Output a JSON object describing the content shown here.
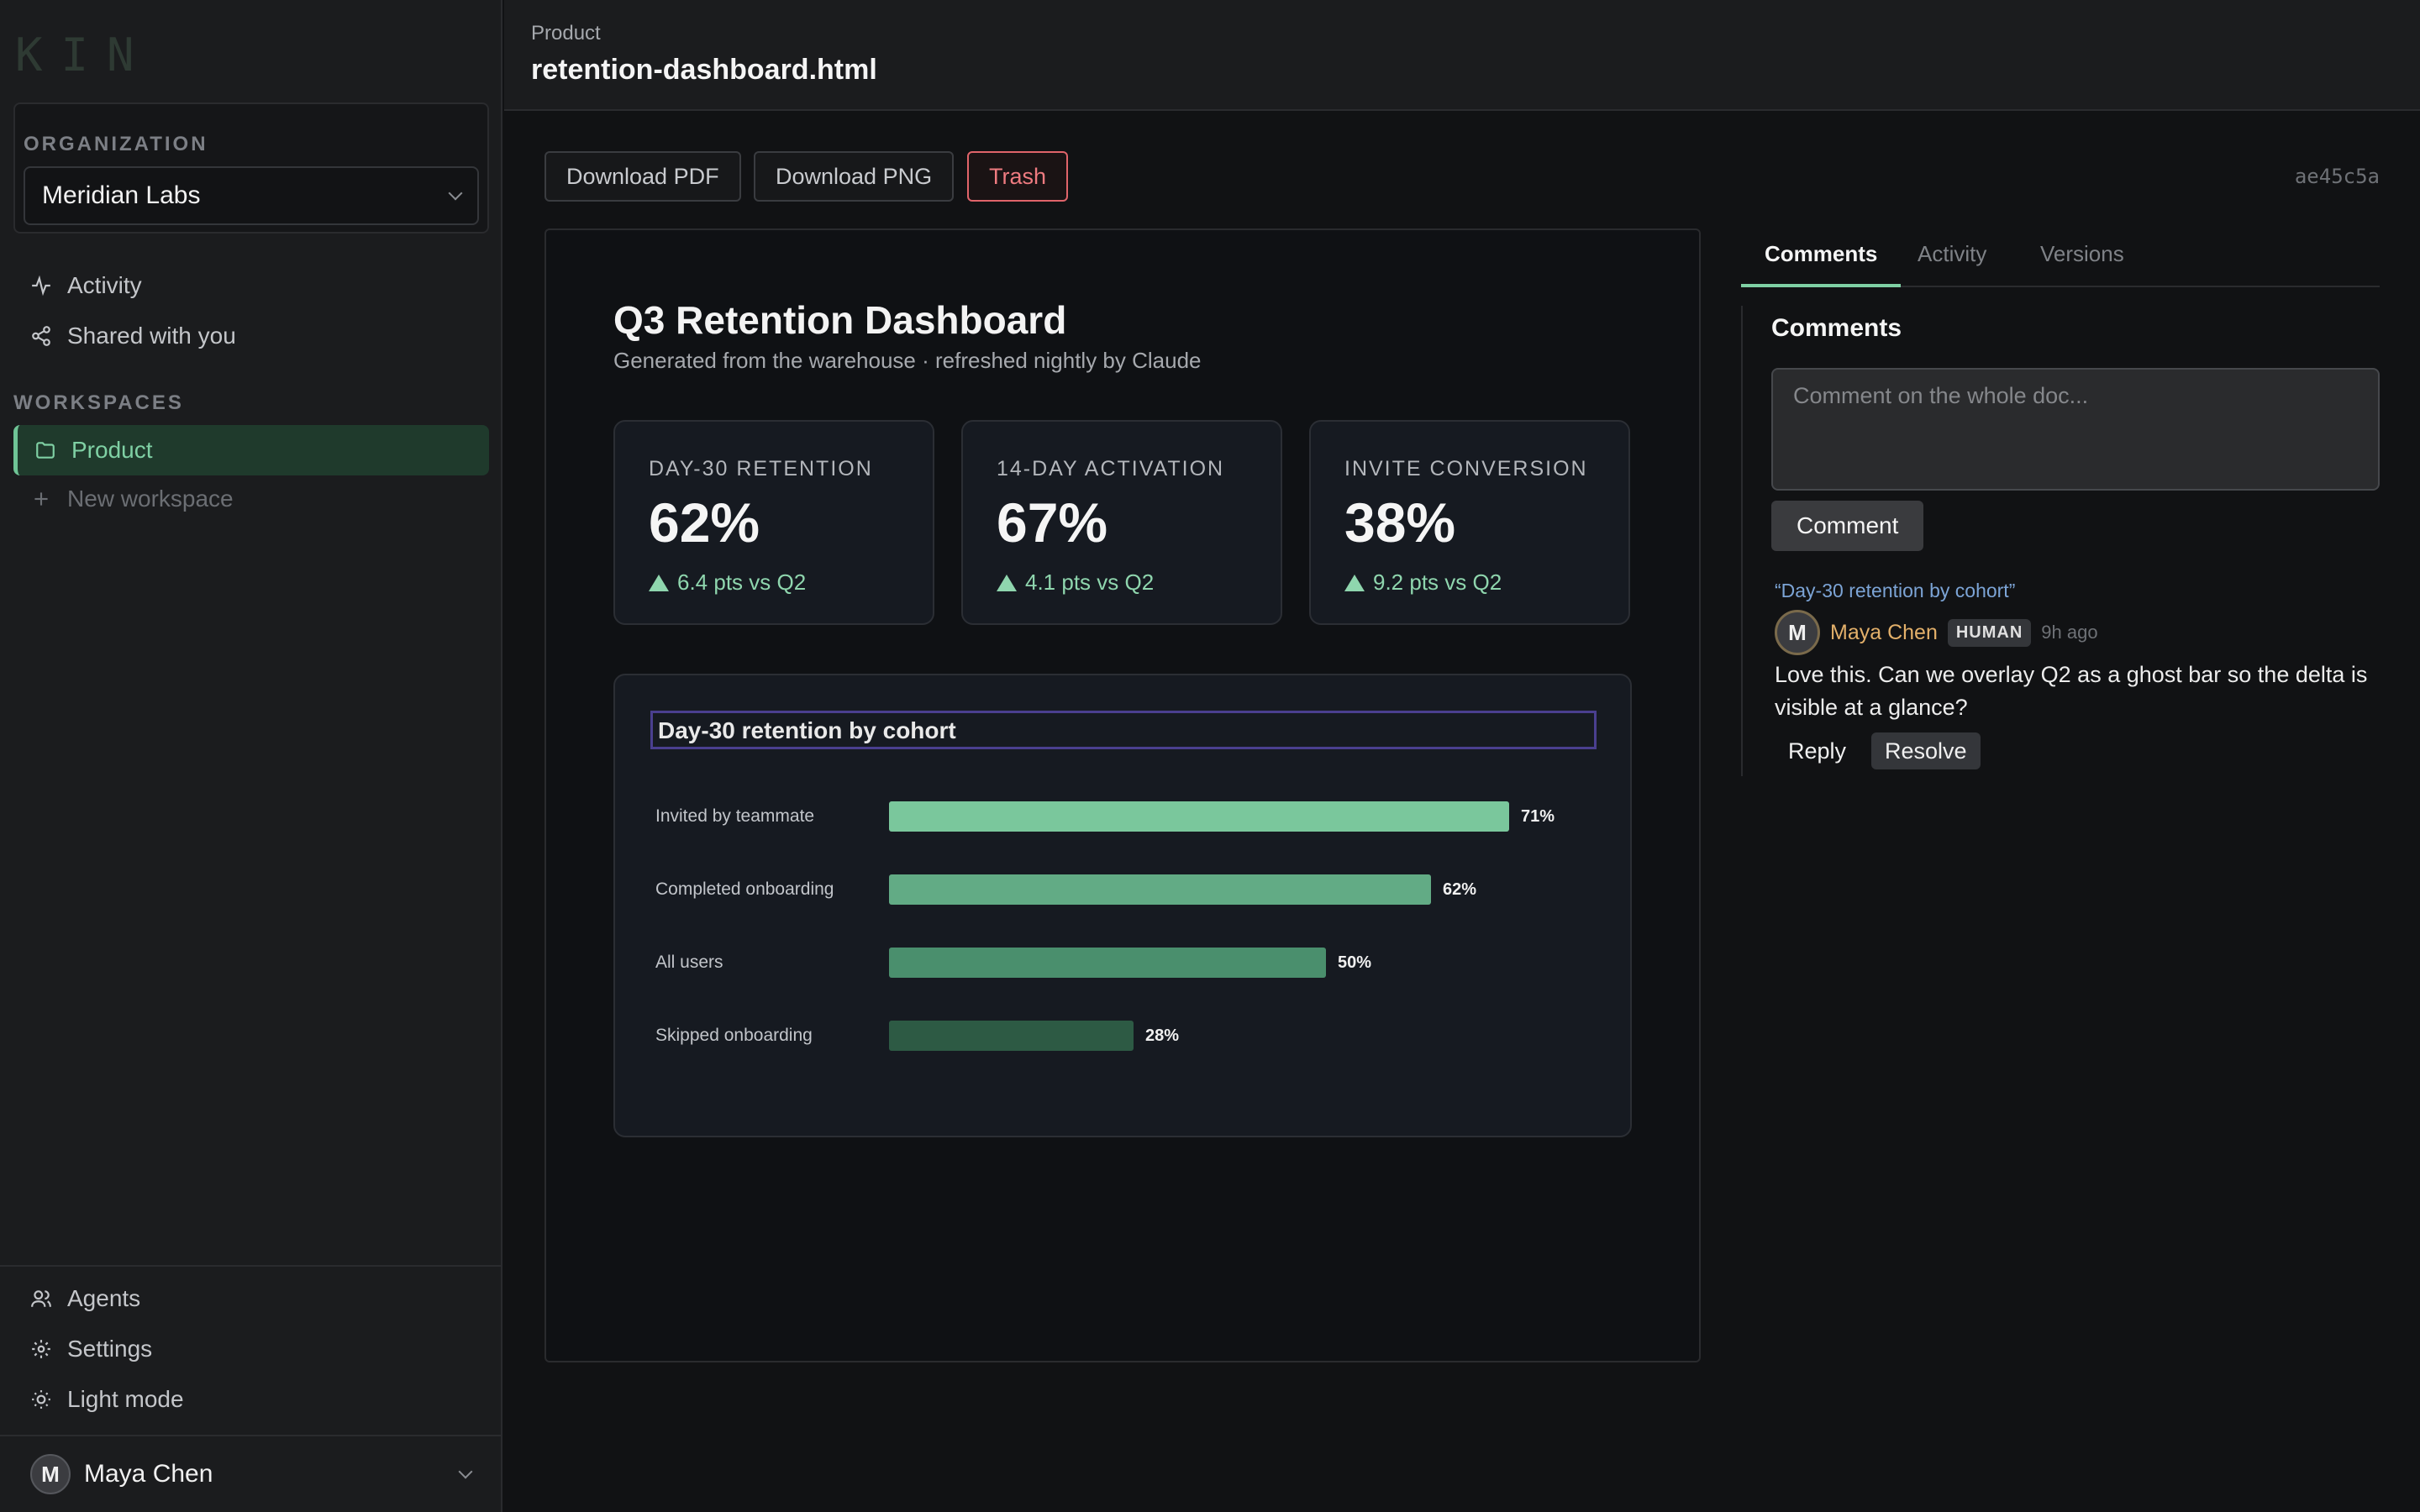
{
  "sidebar": {
    "logo": "KIN",
    "org_label": "ORGANIZATION",
    "org_value": "Meridian Labs",
    "nav": [
      {
        "label": "Activity",
        "icon": "activity-icon"
      },
      {
        "label": "Shared with you",
        "icon": "share-icon"
      }
    ],
    "workspaces_label": "WORKSPACES",
    "workspaces": [
      {
        "label": "Product",
        "icon": "folder-icon",
        "active": true
      }
    ],
    "new_workspace": "New workspace",
    "bottom": [
      {
        "label": "Agents",
        "icon": "users-icon"
      },
      {
        "label": "Settings",
        "icon": "gear-icon"
      },
      {
        "label": "Light mode",
        "icon": "sun-icon"
      }
    ],
    "user": {
      "initial": "M",
      "name": "Maya Chen"
    }
  },
  "header": {
    "breadcrumb": "Product",
    "filename": "retention-dashboard.html"
  },
  "toolbar": {
    "download_pdf": "Download PDF",
    "download_png": "Download PNG",
    "trash": "Trash",
    "hash": "ae45c5a"
  },
  "document": {
    "title": "Q3 Retention Dashboard",
    "subtitle": "Generated from the warehouse · refreshed nightly by Claude",
    "kpis": [
      {
        "label": "DAY-30 RETENTION",
        "value": "62%",
        "delta": "6.4 pts vs Q2"
      },
      {
        "label": "14-DAY ACTIVATION",
        "value": "67%",
        "delta": "4.1 pts vs Q2"
      },
      {
        "label": "INVITE CONVERSION",
        "value": "38%",
        "delta": "9.2 pts vs Q2"
      }
    ]
  },
  "chart_data": {
    "type": "bar",
    "title": "Day-30 retention by cohort",
    "categories": [
      "Invited by teammate",
      "Completed onboarding",
      "All users",
      "Skipped onboarding"
    ],
    "values": [
      71,
      62,
      50,
      28
    ],
    "value_labels": [
      "71%",
      "62%",
      "50%",
      "28%"
    ],
    "colors": [
      "#7ac79c",
      "#62ab85",
      "#4a8f6d",
      "#2d5a44"
    ],
    "xlim": [
      0,
      100
    ],
    "grid": false
  },
  "panel": {
    "tabs": [
      "Comments",
      "Activity",
      "Versions"
    ],
    "active_tab": "Comments",
    "heading": "Comments",
    "input_placeholder": "Comment on the whole doc...",
    "comment_button": "Comment",
    "comments": [
      {
        "quote": "“Day-30 retention by cohort”",
        "initial": "M",
        "author": "Maya Chen",
        "badge": "HUMAN",
        "time": "9h ago",
        "body": "Love this. Can we overlay Q2 as a ghost bar so the delta is visible at a glance?",
        "reply": "Reply",
        "resolve": "Resolve"
      }
    ]
  },
  "colors": {
    "accent": "#7fd0a4",
    "danger": "#ee7b80",
    "background": "#111214",
    "sidebar": "#1b1c1e"
  }
}
